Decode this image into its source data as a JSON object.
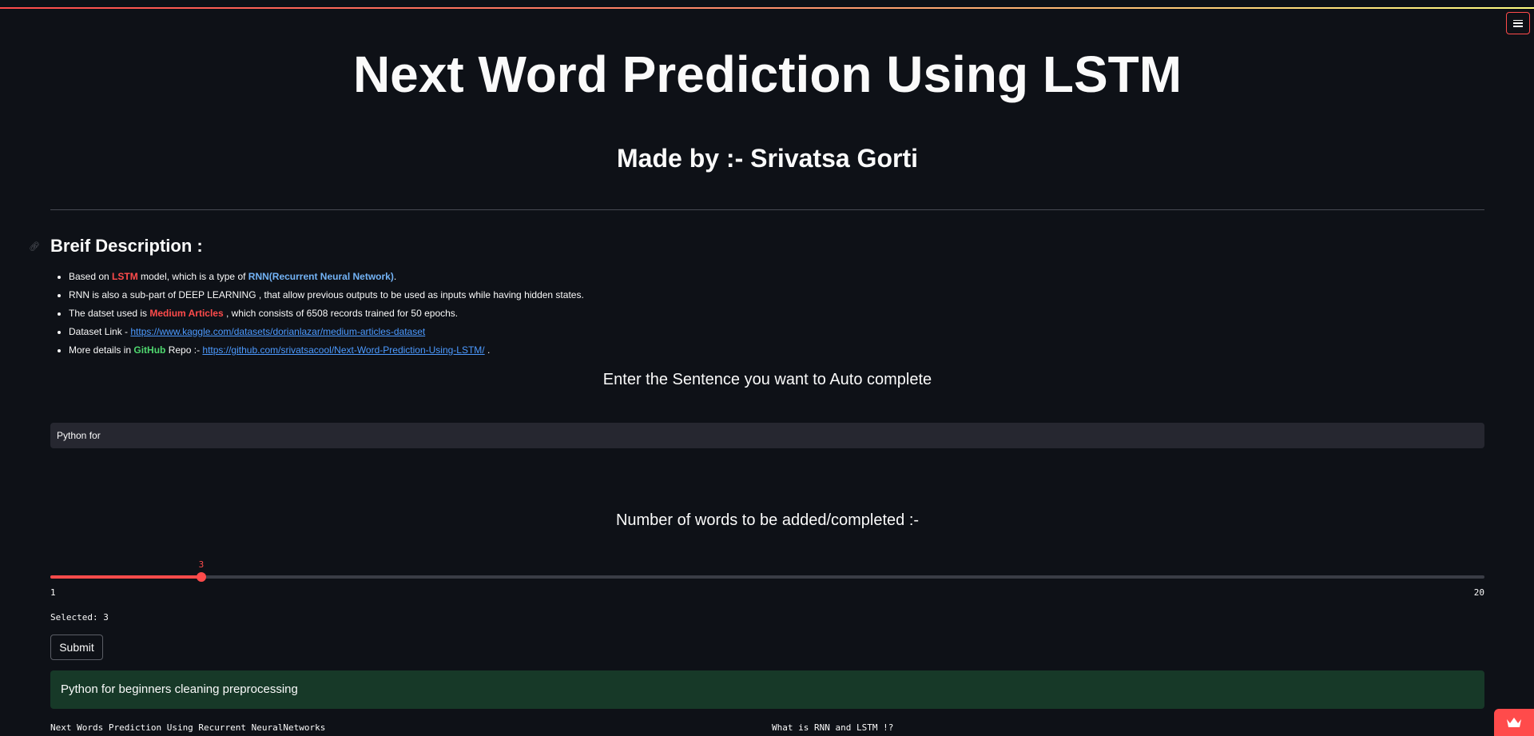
{
  "app": {
    "title": "Next Word Prediction Using LSTM",
    "subtitle": "Made by :- Srivatsa Gorti"
  },
  "description": {
    "heading": "Breif Description :",
    "bullet1": {
      "pre": "Based on ",
      "lstm": "LSTM",
      "mid": " model, which is a type of ",
      "rnn": "RNN(Recurrent Neural Network)",
      "post": "."
    },
    "bullet2": "RNN is also a sub-part of DEEP LEARNING , that allow previous outputs to be used as inputs while having hidden states.",
    "bullet3": {
      "pre": "The datset used is ",
      "dataset": "Medium Articles",
      "post": " , which consists of 6508 records trained for 50 epochs."
    },
    "bullet4": {
      "pre": "Dataset Link - ",
      "link": "https://www.kaggle.com/datasets/dorianlazar/medium-articles-dataset"
    },
    "bullet5": {
      "pre": "More details in ",
      "github": "GitHub",
      "mid": " Repo :- ",
      "link": "https://github.com/srivatsacool/Next-Word-Prediction-Using-LSTM/",
      "post": " ."
    }
  },
  "input_section": {
    "label": "Enter the Sentence you want to Auto complete",
    "value": "Python for"
  },
  "slider": {
    "label": "Number of words to be added/completed :-",
    "min": 1,
    "max": 20,
    "value": 3,
    "value_label": "3",
    "min_label": "1",
    "max_label": "20"
  },
  "selected_text": "Selected: 3",
  "submit_label": "Submit",
  "result_text": "Python for beginners cleaning preprocessing",
  "bottom": {
    "left": "Next Words Prediction Using Recurrent NeuralNetworks",
    "right": "What is RNN and LSTM !?"
  },
  "icons": {
    "menu": "hamburger-menu-icon",
    "crown": "crown-icon",
    "anchor": "link-anchor-icon"
  },
  "colors": {
    "accent": "#ff4b4b",
    "background": "#0e1117",
    "success_bg": "#173928",
    "link": "#4c9aff"
  }
}
